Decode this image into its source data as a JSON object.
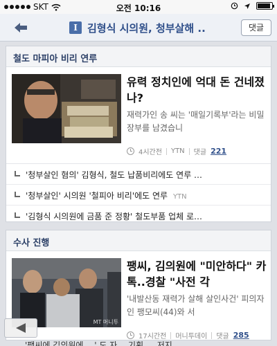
{
  "status_bar": {
    "carrier": "SKT",
    "time": "오전 10:16"
  },
  "nav": {
    "badge": "I",
    "title": "김형식 시의원, 청부살해 ..",
    "reply_label": "댓글"
  },
  "sections": [
    {
      "header": "철도 마피아 비리 연루",
      "story": {
        "title": "유력 정치인에 억대 돈 건네졌나?",
        "summary": "재력가인 송 씨는 '매일기록부'라는 비밀 장부를 남겼습니",
        "time": "4시간전",
        "source": "YTN",
        "comment_label": "댓글",
        "comment_count": "221"
      },
      "related": [
        {
          "text": "'청부살인 혐의' 김형식, 철도 납품비리에도 연루 …",
          "source": ""
        },
        {
          "text": "'청부살인' 시의원 '철피아 비리'에도 연루",
          "source": "YTN"
        },
        {
          "text": "'김형식 시의원에 금품 준 정황' 철도부품 업체 로…",
          "source": ""
        }
      ]
    },
    {
      "header": "수사 진행",
      "story": {
        "title": "팽씨, 김의원에 \"미안하다\" 카톡..경찰 \"사전 각",
        "summary": "'내발산동 재력가 살해 살인사건' 피의자인 팽모씨(44)와 서",
        "time": "17시간전",
        "source": "머니투데이",
        "comment_label": "댓글",
        "comment_count": "285",
        "image_watermark": "MT 머니투"
      }
    }
  ],
  "bottom_peek": "'팽씨에 김의원에 …' 도 자… 기획 … 저지 …",
  "colors": {
    "accent": "#2f4f8a",
    "badge": "#4a6ea9",
    "page_background": "#dfe1e6"
  }
}
